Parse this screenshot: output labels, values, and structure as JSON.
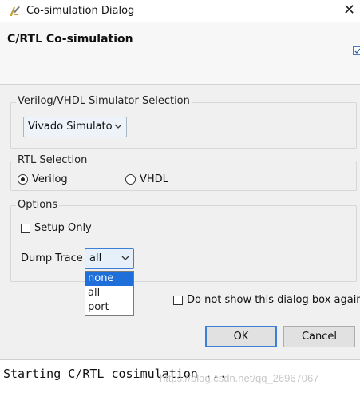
{
  "window": {
    "title": "Co-simulation Dialog",
    "close_glyph": "✕"
  },
  "header": {
    "title": "C/RTL Co-simulation"
  },
  "simulator_group": {
    "label": "Verilog/VHDL Simulator Selection",
    "selected_value": "Vivado Simulator"
  },
  "rtl_group": {
    "label": "RTL Selection",
    "options": [
      {
        "label": "Verilog",
        "checked": true
      },
      {
        "label": "VHDL",
        "checked": false
      }
    ]
  },
  "options_group": {
    "label": "Options",
    "setup_only_label": "Setup Only",
    "setup_only_checked": false,
    "dump_trace_label": "Dump Trace",
    "dump_trace_value": "all",
    "dump_trace_options": [
      "none",
      "all",
      "port"
    ],
    "highlighted_option": "none"
  },
  "footer": {
    "dont_show_label": "Do not show this dialog box again.",
    "dont_show_checked": false,
    "ok_label": "OK",
    "cancel_label": "Cancel"
  },
  "console": {
    "text": "Starting C/RTL cosimulation ..."
  },
  "watermark": "https://blog.csdn.net/qq_26967067",
  "colors": {
    "accent": "#1e6fd9",
    "button_default_border": "#3c7fd6",
    "dialog_bg": "#f0f0f0"
  },
  "icons": {
    "app": "vivado-logo-icon",
    "close": "close-icon",
    "chevron": "chevron-down-icon"
  }
}
